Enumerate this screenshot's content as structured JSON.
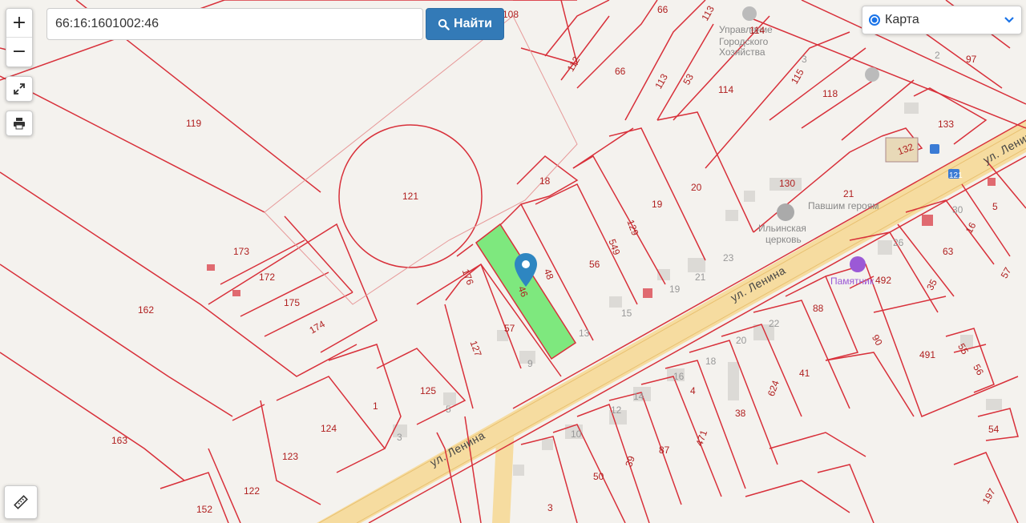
{
  "search": {
    "value": "66:16:1601002:46"
  },
  "search_button": {
    "label": "Найти",
    "icon": "search-icon"
  },
  "zoom": {
    "in_label": "+",
    "out_label": "−"
  },
  "tools": {
    "fullscreen_icon": "expand-arrows-icon",
    "print_icon": "printer-icon",
    "ruler_icon": "ruler-icon"
  },
  "layer_select": {
    "selected": "Карта"
  },
  "colors": {
    "parcel_line": "#d8303a",
    "selected_parcel": "#7ee87e",
    "road": "#f6dca0",
    "accent": "#337ab7",
    "poi_marker": "#9b59d6"
  },
  "streets": [
    "ул. Ленина",
    "ул. Ленина",
    "ул. Ленина"
  ],
  "pois": {
    "admin_line1": "Управление",
    "admin_line2": "Городского",
    "admin_line3": "Хозяйства",
    "memorial": "Павшим героям",
    "church_line1": "Ильинская",
    "church_line2": "церковь",
    "monument": "Памятник"
  },
  "parcel_labels": [
    "108",
    "66",
    "113",
    "114",
    "97",
    "112",
    "66",
    "113",
    "53",
    "114",
    "115",
    "118",
    "3",
    "2",
    "133",
    "132",
    "119",
    "121",
    "18",
    "19",
    "20",
    "130",
    "173",
    "172",
    "175",
    "174",
    "162",
    "176",
    "46",
    "48",
    "56",
    "549",
    "129",
    "57",
    "127",
    "9",
    "13",
    "15",
    "19",
    "21",
    "23",
    "125",
    "1",
    "124",
    "123",
    "122",
    "152",
    "163",
    "5",
    "3",
    "30",
    "16",
    "5",
    "26",
    "63",
    "492",
    "35",
    "57",
    "88",
    "22",
    "20",
    "18",
    "16",
    "14",
    "12",
    "10",
    "90",
    "491",
    "55",
    "56",
    "41",
    "624",
    "4",
    "471",
    "38",
    "87",
    "39",
    "50",
    "3",
    "54",
    "197",
    "21",
    "121"
  ]
}
